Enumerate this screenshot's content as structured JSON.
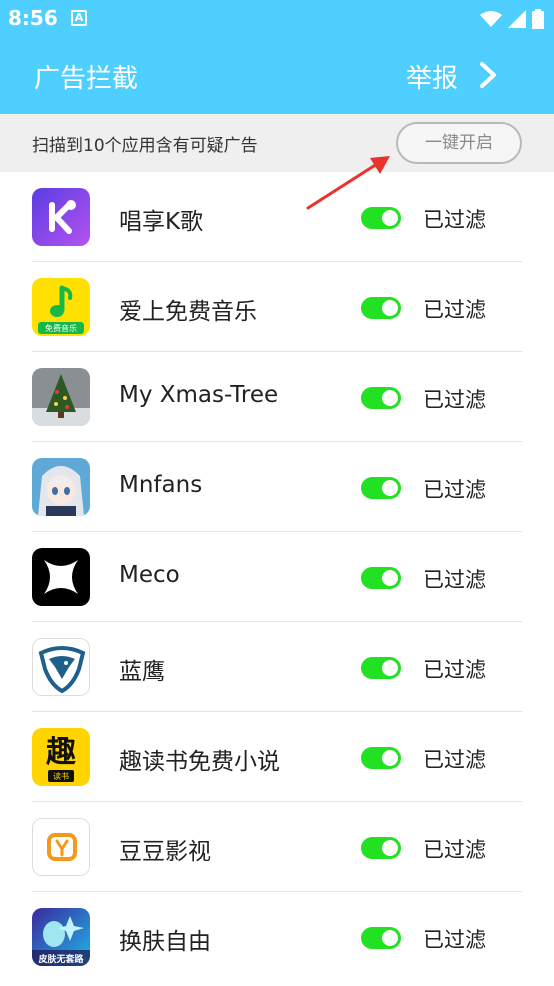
{
  "status_bar": {
    "time": "8:56",
    "notif_icon": "A"
  },
  "app_bar": {
    "title": "广告拦截",
    "report_label": "举报"
  },
  "banner": {
    "message": "扫描到10个应用含有可疑广告",
    "button_label": "一键开启"
  },
  "colors": {
    "header": "#4fcfff",
    "toggle_on": "#22e022",
    "annotation_arrow": "#e8322b"
  },
  "apps": [
    {
      "name": "唱享K歌",
      "status": "已过滤",
      "filter_on": true,
      "icon": "karaoke-k-icon"
    },
    {
      "name": "爱上免费音乐",
      "status": "已过滤",
      "filter_on": true,
      "icon": "music-note-icon",
      "icon_caption": "免费音乐"
    },
    {
      "name": "My Xmas-Tree",
      "status": "已过滤",
      "filter_on": true,
      "icon": "xmas-tree-icon"
    },
    {
      "name": "Mnfans",
      "status": "已过滤",
      "filter_on": true,
      "icon": "anime-girl-icon"
    },
    {
      "name": "Meco",
      "status": "已过滤",
      "filter_on": true,
      "icon": "meco-star-icon"
    },
    {
      "name": "蓝鹰",
      "status": "已过滤",
      "filter_on": true,
      "icon": "eagle-icon"
    },
    {
      "name": "趣读书免费小说",
      "status": "已过滤",
      "filter_on": true,
      "icon": "qu-reading-icon",
      "icon_glyph": "趣",
      "icon_caption": "读书"
    },
    {
      "name": "豆豆影视",
      "status": "已过滤",
      "filter_on": true,
      "icon": "video-y-icon"
    },
    {
      "name": "换肤自由",
      "status": "已过滤",
      "filter_on": true,
      "icon": "skin-game-icon",
      "icon_caption": "皮肤无套路"
    }
  ]
}
